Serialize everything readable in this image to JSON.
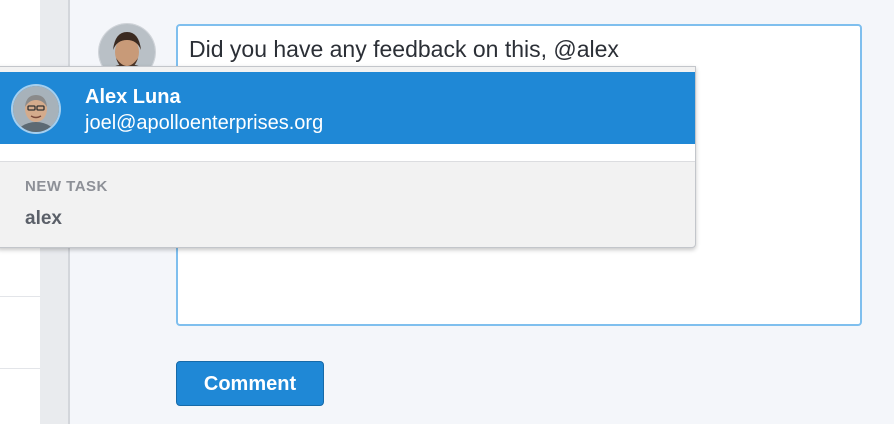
{
  "composer": {
    "text": "Did you have any feedback on this, @alex"
  },
  "mention_dropdown": {
    "suggestion": {
      "name": "Alex Luna",
      "email": "joel@apolloenterprises.org"
    },
    "new_task": {
      "heading": "NEW TASK",
      "value": "alex"
    }
  },
  "actions": {
    "comment_label": "Comment"
  },
  "colors": {
    "accent": "#1f88d6",
    "focus_border": "#7fbfee",
    "background": "#f4f6fa"
  }
}
